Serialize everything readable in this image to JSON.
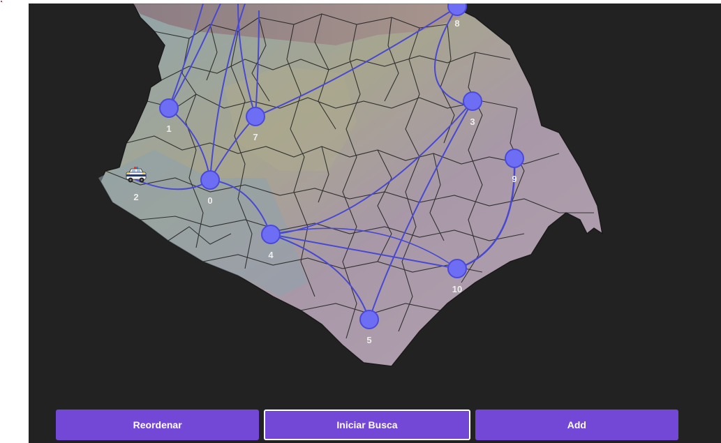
{
  "map": {
    "nodes": [
      {
        "id": "0",
        "label": "0"
      },
      {
        "id": "1",
        "label": "1"
      },
      {
        "id": "2",
        "label": "2"
      },
      {
        "id": "3",
        "label": "3"
      },
      {
        "id": "4",
        "label": "4"
      },
      {
        "id": "5",
        "label": "5"
      },
      {
        "id": "7",
        "label": "7"
      },
      {
        "id": "8",
        "label": "8"
      },
      {
        "id": "9",
        "label": "9"
      },
      {
        "id": "10",
        "label": "10"
      }
    ],
    "vehicle_icon": "police-car-icon",
    "colors": {
      "node_fill": "#6e6ef5",
      "node_stroke": "#4a4ad8",
      "edge": "#4848d0",
      "background": "#222222",
      "district_border": "#1a1a1a"
    }
  },
  "buttons": {
    "reorder": "Reordenar",
    "start_search": "Iniciar Busca",
    "add": "Add"
  },
  "colors": {
    "button": "#7448d6",
    "button_text": "#ffffff"
  }
}
